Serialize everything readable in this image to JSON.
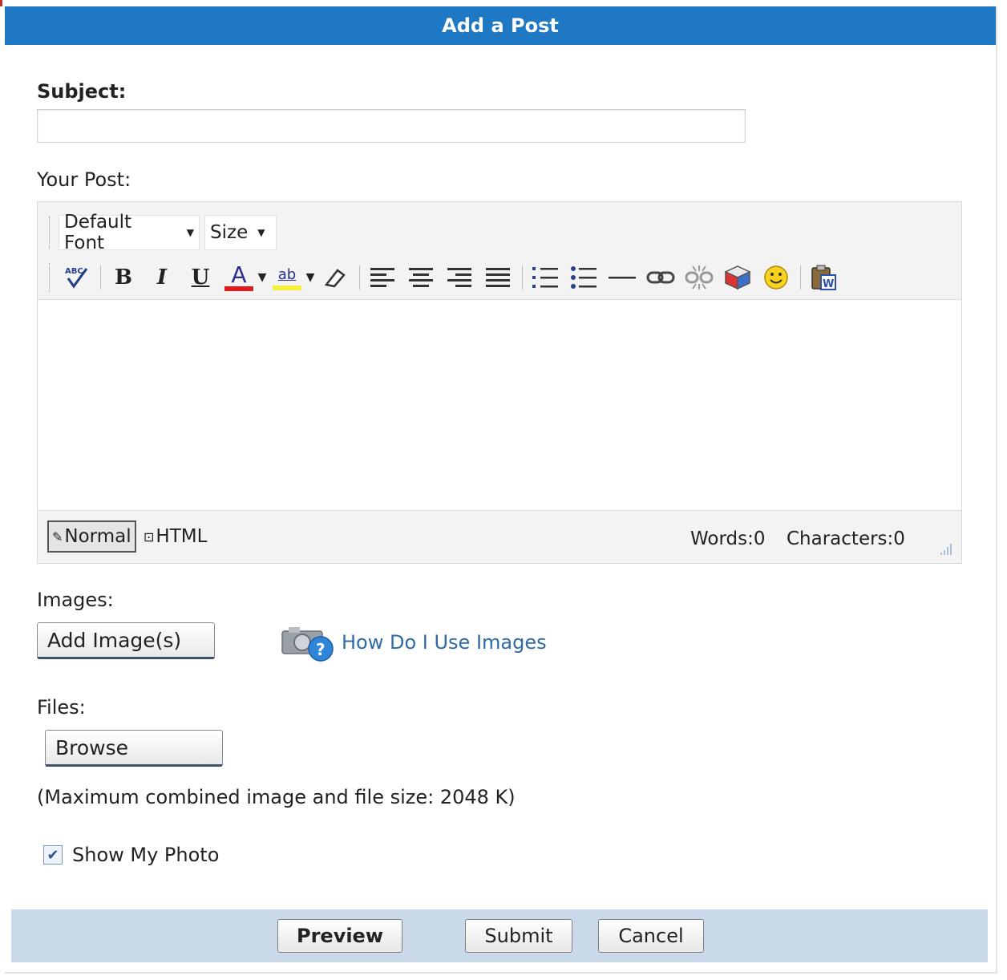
{
  "header": {
    "title": "Add a Post"
  },
  "subject": {
    "label": "Subject:",
    "value": ""
  },
  "post": {
    "label": "Your Post:"
  },
  "editor": {
    "font_dropdown": "Default Font",
    "size_dropdown": "Size",
    "tools": [
      "spellcheck-icon",
      "bold-icon",
      "italic-icon",
      "underline-icon",
      "font-color-icon",
      "highlight-icon",
      "eraser-icon",
      "align-left-icon",
      "align-center-icon",
      "align-right-icon",
      "align-justify-icon",
      "numbered-list-icon",
      "bullet-list-icon",
      "horizontal-rule-icon",
      "link-icon",
      "unlink-icon",
      "insert-media-icon",
      "smiley-icon",
      "paste-from-word-icon"
    ],
    "bold_glyph": "B",
    "italic_glyph": "I",
    "underline_glyph": "U",
    "fontcolor_glyph": "A",
    "highlight_glyph": "ab",
    "mode_normal": "Normal",
    "mode_html": "HTML",
    "words": "Words:0",
    "characters": "Characters:0"
  },
  "images": {
    "label": "Images:",
    "add_button": "Add Image(s)",
    "help_link": "How Do I Use Images"
  },
  "files": {
    "label": "Files:",
    "browse_button": "Browse",
    "note": "(Maximum combined image and file size: 2048 K)"
  },
  "photo": {
    "label": "Show My Photo",
    "checked": true
  },
  "footer": {
    "preview": "Preview",
    "submit": "Submit",
    "cancel": "Cancel"
  },
  "colors": {
    "header": "#1e78c4",
    "footer": "#c9d9e9",
    "link": "#2f6aa7"
  }
}
